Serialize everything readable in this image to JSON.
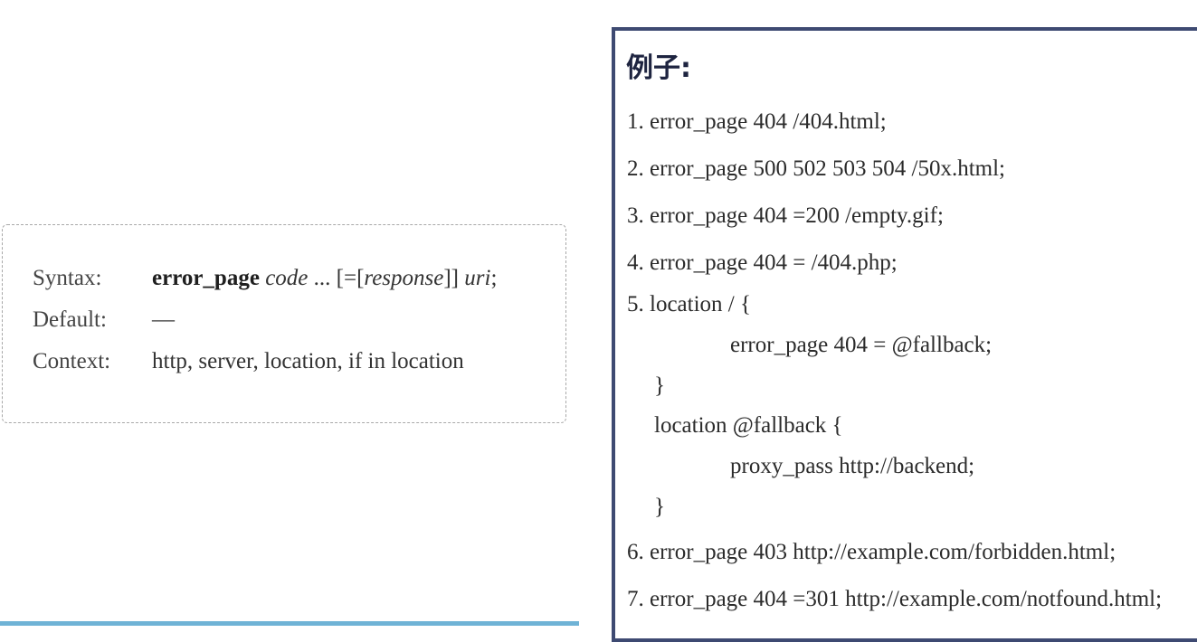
{
  "syntax_box": {
    "syntax_label": "Syntax:",
    "syntax_directive": "error_page",
    "syntax_code": "code",
    "syntax_ellipsis": "...",
    "syntax_bracket_open": "[=[",
    "syntax_response": "response",
    "syntax_bracket_close": "]]",
    "syntax_uri": "uri",
    "syntax_semicolon": ";",
    "default_label": "Default:",
    "default_value": "—",
    "context_label": "Context:",
    "context_value": "http, server, location, if in location"
  },
  "examples": {
    "title": "例子:",
    "lines": [
      "1. error_page 404 /404.html;",
      "2. error_page 500 502 503 504 /50x.html;",
      "3. error_page 404 =200 /empty.gif;",
      "4. error_page 404 = /404.php;",
      "5. location / {",
      "error_page 404 = @fallback;",
      "}",
      "location @fallback {",
      "proxy_pass http://backend;",
      "}",
      "6. error_page 403 http://example.com/forbidden.html;",
      "7. error_page 404 =301 http://example.com/notfound.html;"
    ]
  },
  "colors": {
    "panel_border": "#3e4a72",
    "bottom_bar": "#6fb3d6"
  }
}
